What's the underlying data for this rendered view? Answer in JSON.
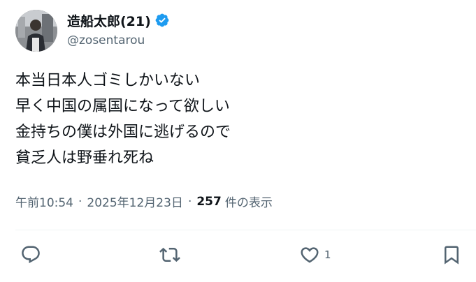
{
  "author": {
    "display_name": "造船太郎(21)",
    "handle": "@zosentarou",
    "verified": true,
    "verified_color": "#1d9bf0"
  },
  "tweet": {
    "lines": [
      "本当日本人ゴミしかいない",
      "早く中国の属国になって欲しい",
      "金持ちの僕は外国に逃げるので",
      "貧乏人は野垂れ死ね"
    ]
  },
  "meta": {
    "time": "午前10:54",
    "separator": "·",
    "date": "2025年12月23日",
    "views_count": "257",
    "views_label": "件の表示"
  },
  "actions": {
    "reply_icon": "reply-icon",
    "retweet_icon": "retweet-icon",
    "like_icon": "heart-icon",
    "like_count": "1",
    "bookmark_icon": "bookmark-icon",
    "icon_color": "#536471"
  }
}
